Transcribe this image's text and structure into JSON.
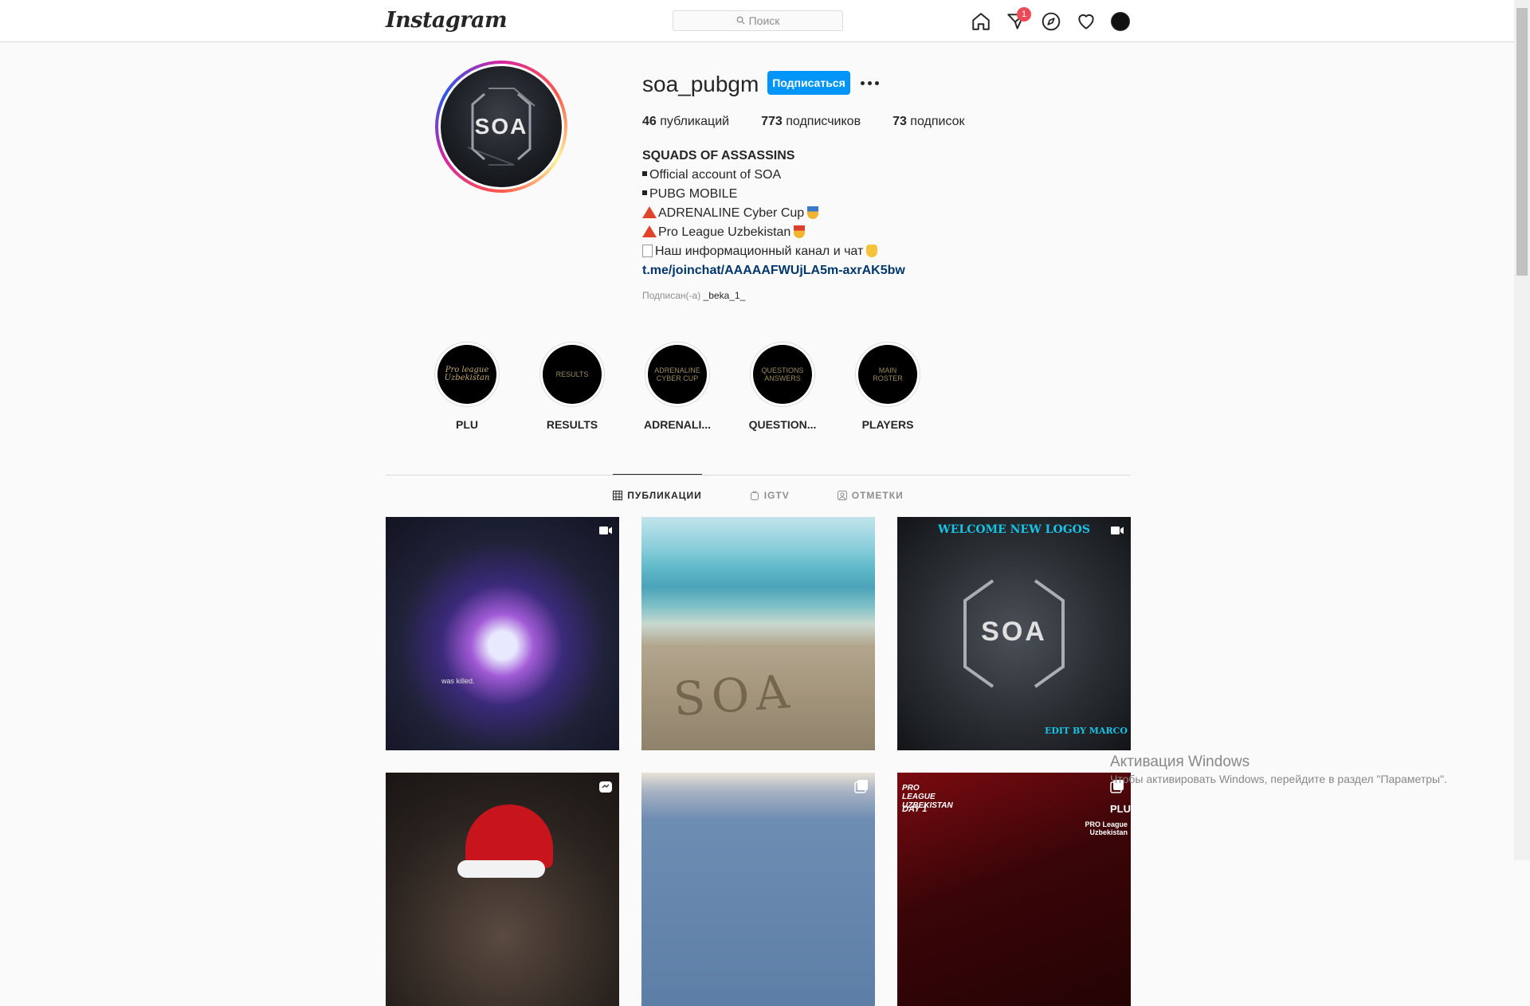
{
  "header": {
    "logo": "Instagram",
    "search_placeholder": "Поиск",
    "notification_count": "1"
  },
  "profile": {
    "username": "soa_pubgm",
    "avatar_text": "SOA",
    "follow_label": "Подписаться",
    "stats": {
      "posts_count": "46",
      "posts_label": " публикаций",
      "followers_count": "773",
      "followers_label": " подписчиков",
      "following_count": "73",
      "following_label": " подписок"
    },
    "bio": {
      "title": "SQUADS OF ASSASSINS",
      "line1": "Official account of SOA",
      "line2": "PUBG MOBILE",
      "line3": "ADRENALINE Cyber Cup",
      "line4": "Pro League Uzbekistan",
      "line5": "Наш информационный канал и чат",
      "link": "t.me/joinchat/AAAAAFWUjLA5m-axrAK5bw"
    },
    "followed_by_label": "Подписан(-а)",
    "followed_by_name": "_beka_1_"
  },
  "highlights": [
    {
      "label": "PLU",
      "cover_text": "Pro league Uzbekistan"
    },
    {
      "label": "RESULTS",
      "cover_text": "RESULTS"
    },
    {
      "label": "ADRENALI...",
      "cover_text": "ADRENALINE CYBER CUP"
    },
    {
      "label": "QUESTION...",
      "cover_text": "QUESTIONS ANSWERS"
    },
    {
      "label": "PLAYERS",
      "cover_text": "MAIN ROSTER"
    }
  ],
  "tabs": [
    {
      "label": "ПУБЛИКАЦИИ",
      "icon": "grid-icon",
      "active": true
    },
    {
      "label": "IGTV",
      "icon": "igtv-icon",
      "active": false
    },
    {
      "label": "ОТМЕТКИ",
      "icon": "tagged-icon",
      "active": false
    }
  ],
  "posts": [
    {
      "type": "video",
      "overlay_text": "was killed."
    },
    {
      "type": "image",
      "overlay_text": "SOA"
    },
    {
      "type": "video",
      "overlay_text": "WELCOME NEW LOGOS",
      "soa": "SOA",
      "credit": "EDIT BY MARCO"
    },
    {
      "type": "igtv",
      "overlay_text": ""
    },
    {
      "type": "carousel",
      "overlay_text": ""
    },
    {
      "type": "carousel",
      "overlay_text": "PRO LEAGUE UZBEKISTAN",
      "day": "DAY 1",
      "brand": "PLU",
      "brand_sub": "PRO League Uzbekistan"
    }
  ],
  "watermark": {
    "line1": "Активация Windows",
    "line2": "Чтобы активировать Windows, перейдите в раздел \"Параметры\"."
  }
}
